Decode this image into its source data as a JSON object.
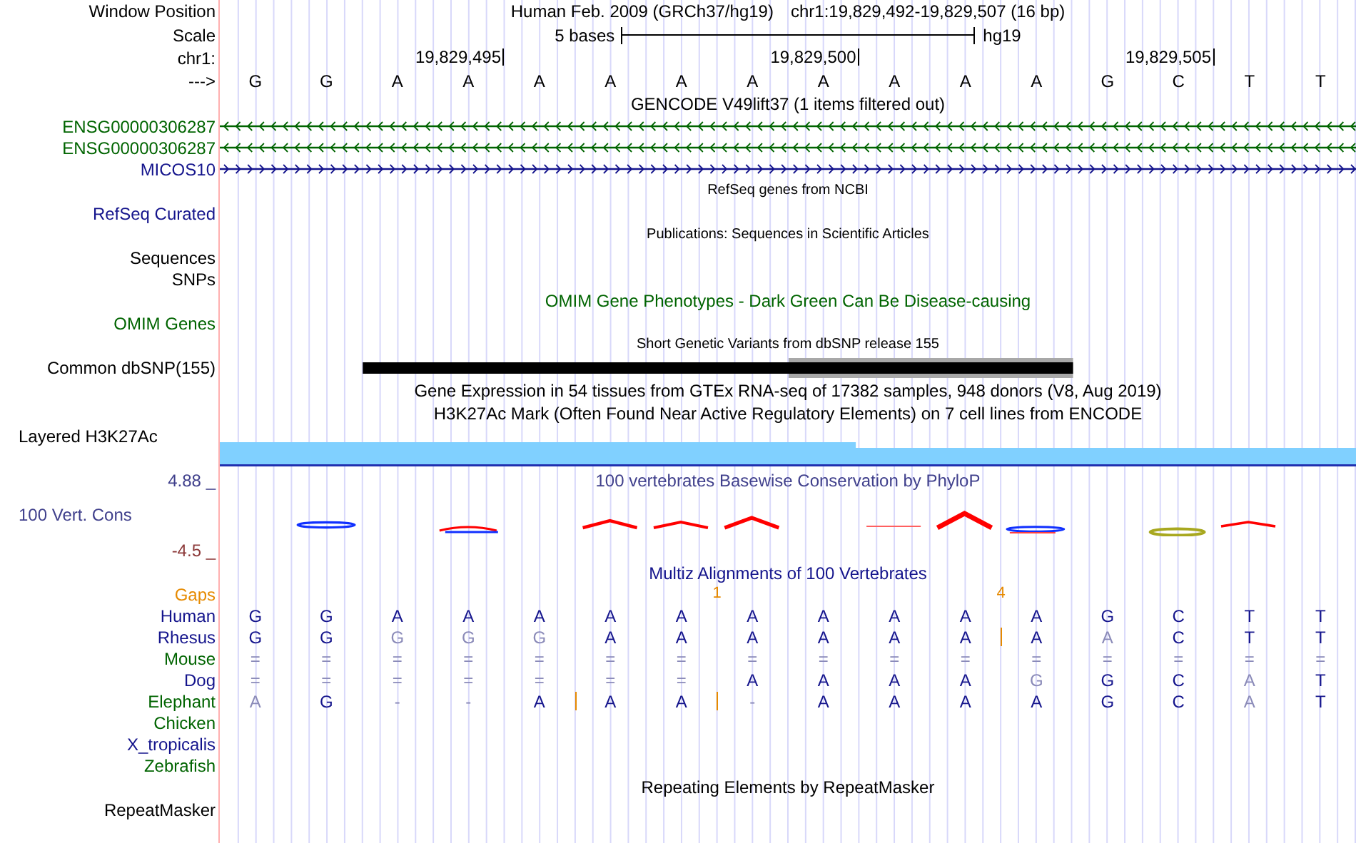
{
  "position_bar": {
    "label": "Window Position",
    "assembly": "Human Feb. 2009 (GRCh37/hg19)",
    "range": "chr1:19,829,492-19,829,507 (16 bp)"
  },
  "scale": {
    "label": "Scale",
    "length": "5 bases",
    "assembly": "hg19"
  },
  "ruler": {
    "label": "chr1:",
    "ticks": [
      "19,829,495",
      "19,829,500",
      "19,829,505"
    ]
  },
  "sequence": {
    "label": "--->",
    "bases": [
      "G",
      "G",
      "A",
      "A",
      "A",
      "A",
      "A",
      "A",
      "A",
      "A",
      "A",
      "A",
      "G",
      "C",
      "T",
      "T"
    ]
  },
  "rows": [
    {
      "kind": "title",
      "title": "GENCODE V49lift37 (1 items filtered out)",
      "color": "#000000"
    },
    {
      "kind": "gene",
      "label": "ENSG00000306287",
      "color": "#006400",
      "reverse": true
    },
    {
      "kind": "gene",
      "label": "ENSG00000306287",
      "color": "#006400",
      "reverse": true
    },
    {
      "kind": "gene",
      "label": "MICOS10",
      "color": "#14148c",
      "reverse": false
    },
    {
      "kind": "small_title",
      "title": "RefSeq genes from NCBI",
      "color": "#000000"
    },
    {
      "kind": "label",
      "label": "RefSeq Curated",
      "color": "#14148c"
    },
    {
      "kind": "small_title",
      "title": "Publications: Sequences in Scientific Articles",
      "color": "#000000"
    },
    {
      "kind": "label",
      "label": "Sequences",
      "color": "#000000"
    },
    {
      "kind": "label",
      "label": "SNPs",
      "color": "#000000"
    },
    {
      "kind": "title",
      "title": "OMIM Gene Phenotypes - Dark Green Can Be Disease-causing",
      "color": "#006400"
    },
    {
      "kind": "label",
      "label": "OMIM Genes",
      "color": "#006400"
    },
    {
      "kind": "small_title",
      "title": "Short Genetic Variants from dbSNP release 155",
      "color": "#000000"
    },
    {
      "kind": "snp",
      "label": "Common dbSNP(155)",
      "color": "#000000"
    },
    {
      "kind": "title",
      "title": "Gene Expression in 54 tissues from GTEx RNA-seq of 17382 samples, 948 donors (V8, Aug 2019)",
      "color": "#000000"
    },
    {
      "kind": "title",
      "title": "H3K27Ac Mark (Often Found Near Active Regulatory Elements) on 7 cell lines from ENCODE",
      "color": "#000000"
    },
    {
      "kind": "signal",
      "label": "Layered H3K27Ac",
      "color": "#000000"
    },
    {
      "kind": "conservation",
      "label": "100 Vert. Cons",
      "max": "4.88 _",
      "min": "-4.5 _",
      "title": "100 vertebrates Basewise Conservation by PhyloP",
      "color": "#40408c"
    },
    {
      "kind": "title",
      "title": "Multiz Alignments of 100 Vertebrates",
      "color": "#14148c"
    },
    {
      "kind": "gaps",
      "label": "Gaps",
      "counts": [
        "1",
        "4"
      ],
      "color": "#e68a00"
    },
    {
      "kind": "species",
      "label": "Human",
      "color": "#14148c",
      "bases": [
        {
          "text": "G",
          "faded": false,
          "insert": false
        },
        {
          "text": "G",
          "faded": false,
          "insert": false
        },
        {
          "text": "A",
          "faded": false,
          "insert": false
        },
        {
          "text": "A",
          "faded": false,
          "insert": false
        },
        {
          "text": "A",
          "faded": false,
          "insert": false
        },
        {
          "text": "A",
          "faded": false,
          "insert": false
        },
        {
          "text": "A",
          "faded": false,
          "insert": false
        },
        {
          "text": "A",
          "faded": false,
          "insert": false
        },
        {
          "text": "A",
          "faded": false,
          "insert": false
        },
        {
          "text": "A",
          "faded": false,
          "insert": false
        },
        {
          "text": "A",
          "faded": false,
          "insert": false
        },
        {
          "text": "A",
          "faded": false,
          "insert": false
        },
        {
          "text": "G",
          "faded": false,
          "insert": false
        },
        {
          "text": "C",
          "faded": false,
          "insert": false
        },
        {
          "text": "T",
          "faded": false,
          "insert": false
        },
        {
          "text": "T",
          "faded": false,
          "insert": false
        }
      ]
    },
    {
      "kind": "species",
      "label": "Rhesus",
      "color": "#14148c",
      "bases": [
        {
          "text": "G",
          "faded": false,
          "insert": false
        },
        {
          "text": "G",
          "faded": false,
          "insert": false
        },
        {
          "text": "G",
          "faded": true,
          "insert": false
        },
        {
          "text": "G",
          "faded": true,
          "insert": false
        },
        {
          "text": "G",
          "faded": true,
          "insert": false
        },
        {
          "text": "A",
          "faded": false,
          "insert": false
        },
        {
          "text": "A",
          "faded": false,
          "insert": false
        },
        {
          "text": "A",
          "faded": false,
          "insert": false
        },
        {
          "text": "A",
          "faded": false,
          "insert": false
        },
        {
          "text": "A",
          "faded": false,
          "insert": false
        },
        {
          "text": "A",
          "faded": false,
          "insert": false
        },
        {
          "text": "A",
          "faded": false,
          "insert": true
        },
        {
          "text": "A",
          "faded": true,
          "insert": false
        },
        {
          "text": "C",
          "faded": false,
          "insert": false
        },
        {
          "text": "T",
          "faded": false,
          "insert": false
        },
        {
          "text": "T",
          "faded": false,
          "insert": false
        }
      ]
    },
    {
      "kind": "species",
      "label": "Mouse",
      "color": "#006400",
      "bases": [
        {
          "text": "=",
          "faded": true,
          "insert": false
        },
        {
          "text": "=",
          "faded": true,
          "insert": false
        },
        {
          "text": "=",
          "faded": true,
          "insert": false
        },
        {
          "text": "=",
          "faded": true,
          "insert": false
        },
        {
          "text": "=",
          "faded": true,
          "insert": false
        },
        {
          "text": "=",
          "faded": true,
          "insert": false
        },
        {
          "text": "=",
          "faded": true,
          "insert": false
        },
        {
          "text": "=",
          "faded": true,
          "insert": false
        },
        {
          "text": "=",
          "faded": true,
          "insert": false
        },
        {
          "text": "=",
          "faded": true,
          "insert": false
        },
        {
          "text": "=",
          "faded": true,
          "insert": false
        },
        {
          "text": "=",
          "faded": true,
          "insert": false
        },
        {
          "text": "=",
          "faded": true,
          "insert": false
        },
        {
          "text": "=",
          "faded": true,
          "insert": false
        },
        {
          "text": "=",
          "faded": true,
          "insert": false
        },
        {
          "text": "=",
          "faded": true,
          "insert": false
        }
      ]
    },
    {
      "kind": "species",
      "label": "Dog",
      "color": "#14148c",
      "bases": [
        {
          "text": "=",
          "faded": true,
          "insert": false
        },
        {
          "text": "=",
          "faded": true,
          "insert": false
        },
        {
          "text": "=",
          "faded": true,
          "insert": false
        },
        {
          "text": "=",
          "faded": true,
          "insert": false
        },
        {
          "text": "=",
          "faded": true,
          "insert": false
        },
        {
          "text": "=",
          "faded": true,
          "insert": false
        },
        {
          "text": "=",
          "faded": true,
          "insert": false
        },
        {
          "text": "A",
          "faded": false,
          "insert": false
        },
        {
          "text": "A",
          "faded": false,
          "insert": false
        },
        {
          "text": "A",
          "faded": false,
          "insert": false
        },
        {
          "text": "A",
          "faded": false,
          "insert": false
        },
        {
          "text": "G",
          "faded": true,
          "insert": false
        },
        {
          "text": "G",
          "faded": false,
          "insert": false
        },
        {
          "text": "C",
          "faded": false,
          "insert": false
        },
        {
          "text": "A",
          "faded": true,
          "insert": false
        },
        {
          "text": "T",
          "faded": false,
          "insert": false
        }
      ]
    },
    {
      "kind": "species",
      "label": "Elephant",
      "color": "#006400",
      "bases": [
        {
          "text": "A",
          "faded": true,
          "insert": false
        },
        {
          "text": "G",
          "faded": false,
          "insert": false
        },
        {
          "text": "-",
          "faded": true,
          "insert": false
        },
        {
          "text": "-",
          "faded": true,
          "insert": false
        },
        {
          "text": "A",
          "faded": false,
          "insert": false
        },
        {
          "text": "A",
          "faded": false,
          "insert": true
        },
        {
          "text": "A",
          "faded": false,
          "insert": false
        },
        {
          "text": "-",
          "faded": true,
          "insert": true
        },
        {
          "text": "A",
          "faded": false,
          "insert": false
        },
        {
          "text": "A",
          "faded": false,
          "insert": false
        },
        {
          "text": "A",
          "faded": false,
          "insert": false
        },
        {
          "text": "A",
          "faded": false,
          "insert": false
        },
        {
          "text": "G",
          "faded": false,
          "insert": false
        },
        {
          "text": "C",
          "faded": false,
          "insert": false
        },
        {
          "text": "A",
          "faded": true,
          "insert": false
        },
        {
          "text": "T",
          "faded": false,
          "insert": false
        }
      ]
    },
    {
      "kind": "label",
      "label": "Chicken",
      "color": "#006400"
    },
    {
      "kind": "label",
      "label": "X_tropicalis",
      "color": "#14148c"
    },
    {
      "kind": "label",
      "label": "Zebrafish",
      "color": "#006400"
    },
    {
      "kind": "title",
      "title": "Repeating Elements by RepeatMasker",
      "color": "#000000"
    },
    {
      "kind": "label",
      "label": "RepeatMasker",
      "color": "#000000"
    }
  ]
}
